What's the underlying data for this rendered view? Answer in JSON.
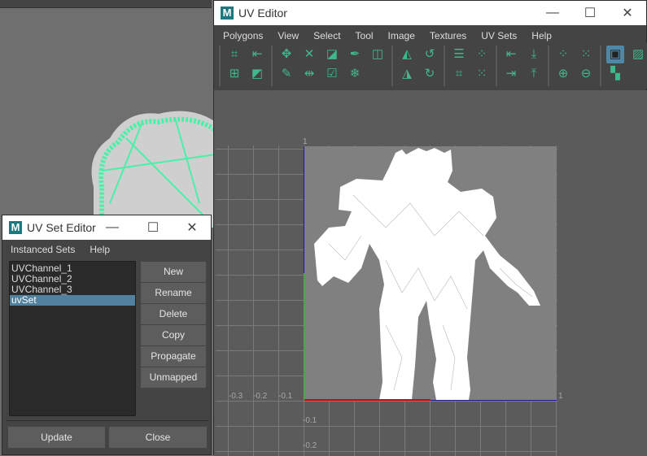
{
  "uv_editor": {
    "title": "UV Editor",
    "menu": [
      "Polygons",
      "View",
      "Select",
      "Tool",
      "Image",
      "Textures",
      "UV Sets",
      "Help"
    ],
    "window_controls": {
      "minimize": "—",
      "maximize": "☐",
      "close": "✕"
    },
    "toolbar_groups": [
      [
        "uv-shell-select-icon",
        "uv-tweak-icon",
        "select-edge-loop-icon",
        "select-backface-icon"
      ],
      [
        "move-uv-icon",
        "cut-icon",
        "sew-icon",
        "mirror-icon",
        "unfold-icon",
        "check-icon",
        "pen-icon",
        "snowflake-icon",
        "distort-icon"
      ],
      [
        "flip-u-icon",
        "flip-v-icon",
        "rotate-ccw-icon",
        "rotate-cw-icon"
      ],
      [
        "layout-icon",
        "gridify-icon",
        "distribute-icon",
        "stack-icon"
      ],
      [
        "align-left-icon",
        "align-right-icon",
        "align-bottom-icon",
        "align-top-icon"
      ],
      [
        "select-uvs-icon",
        "add-uvs-icon",
        "grid-uvs-icon",
        "remove-uvs-icon"
      ],
      [
        "image-display-icon",
        "checker-icon",
        "dim-image-icon"
      ]
    ],
    "axis_labels": {
      "u": [
        "-0.3",
        "-0.2",
        "-0.1",
        "1"
      ],
      "v": [
        "1",
        "-0.1",
        "-0.2"
      ]
    }
  },
  "uv_set_editor": {
    "title": "UV Set Editor",
    "menu": [
      "Instanced Sets",
      "Help"
    ],
    "window_controls": {
      "minimize": "—",
      "maximize": "☐",
      "close": "✕"
    },
    "sets": [
      "UVChannel_1",
      "UVChannel_2",
      "UVChannel_3",
      "uvSet"
    ],
    "selected_set": "uvSet",
    "buttons": [
      "New",
      "Rename",
      "Delete",
      "Copy",
      "Propagate",
      "Unmapped"
    ],
    "update_label": "Update",
    "close_label": "Close"
  },
  "colors": {
    "accent": "#3fb98b",
    "selection": "#52819f",
    "wireframe": "#4af0a8"
  }
}
